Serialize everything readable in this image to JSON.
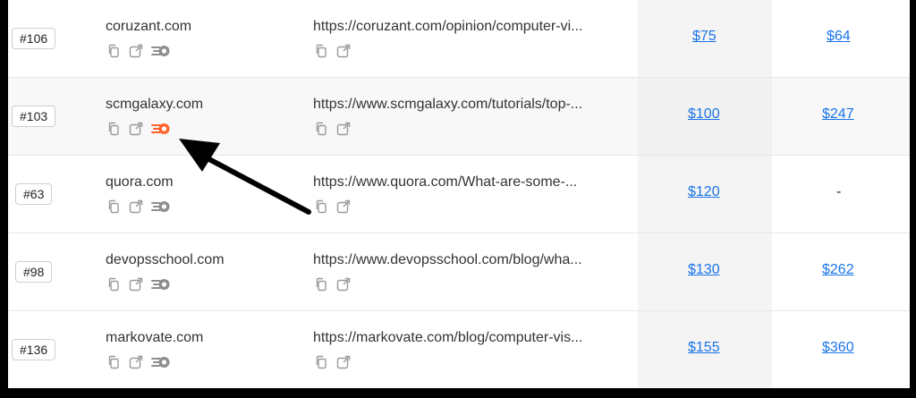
{
  "rows": [
    {
      "rank": "#106",
      "domain": "coruzant.com",
      "url": "https://coruzant.com/opinion/computer-vi...",
      "price1": "$75",
      "price2": "$64",
      "semrush_active": false
    },
    {
      "rank": "#103",
      "domain": "scmgalaxy.com",
      "url": "https://www.scmgalaxy.com/tutorials/top-...",
      "price1": "$100",
      "price2": "$247",
      "semrush_active": true
    },
    {
      "rank": "#63",
      "domain": "quora.com",
      "url": "https://www.quora.com/What-are-some-...",
      "price1": "$120",
      "price2": "-",
      "semrush_active": false
    },
    {
      "rank": "#98",
      "domain": "devopsschool.com",
      "url": "https://www.devopsschool.com/blog/wha...",
      "price1": "$130",
      "price2": "$262",
      "semrush_active": false
    },
    {
      "rank": "#136",
      "domain": "markovate.com",
      "url": "https://markovate.com/blog/computer-vis...",
      "price1": "$155",
      "price2": "$360",
      "semrush_active": false
    }
  ],
  "icons": {
    "copy": "copy-icon",
    "external": "external-link-icon",
    "semrush": "semrush-icon",
    "annotation": "arrow-icon"
  },
  "colors": {
    "link": "#1a73e8",
    "semrush_active": "#ff642d",
    "semrush_inactive": "#8e8e8e",
    "icon": "#9a9a9a"
  }
}
